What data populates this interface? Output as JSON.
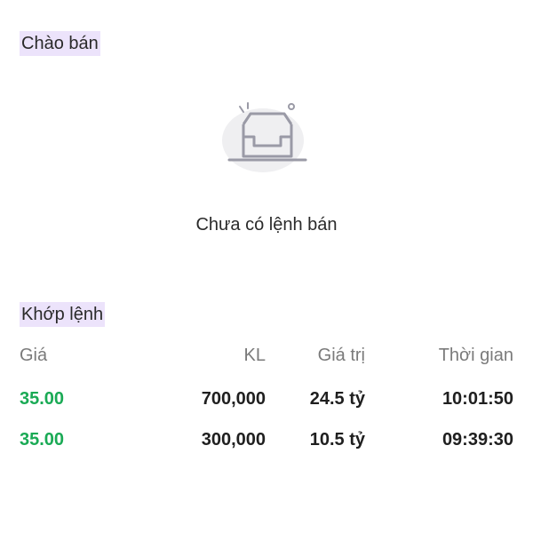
{
  "sell_section": {
    "title": "Chào bán",
    "empty_icon": "empty-inbox-icon",
    "empty_text": "Chưa có lệnh bán"
  },
  "match_section": {
    "title": "Khớp lệnh",
    "columns": {
      "price": "Giá",
      "volume": "KL",
      "value": "Giá trị",
      "time": "Thời gian"
    },
    "rows": [
      {
        "price": "35.00",
        "volume": "700,000",
        "value": "24.5 tỷ",
        "time": "10:01:50"
      },
      {
        "price": "35.00",
        "volume": "300,000",
        "value": "10.5 tỷ",
        "time": "09:39:30"
      }
    ]
  },
  "colors": {
    "title_highlight": "#ece3fb",
    "price_up": "#1aaa55"
  }
}
